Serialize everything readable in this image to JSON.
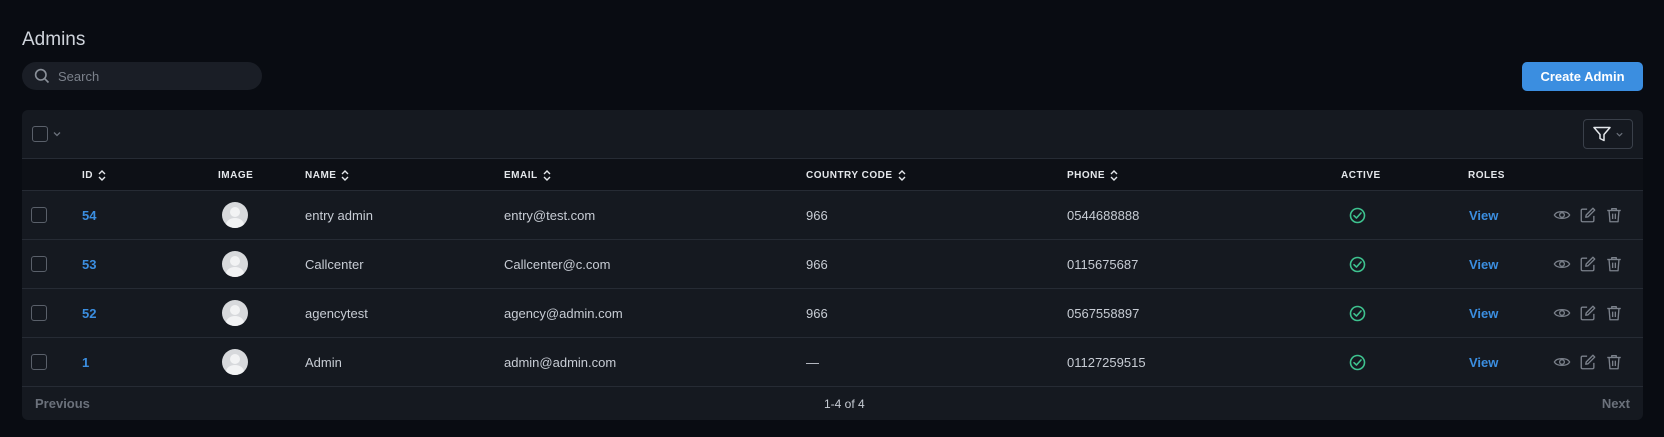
{
  "page": {
    "title": "Admins",
    "search_placeholder": "Search",
    "create_label": "Create Admin"
  },
  "table": {
    "columns": {
      "id": "ID",
      "image": "IMAGE",
      "name": "NAME",
      "email": "EMAIL",
      "country_code": "COUNTRY CODE",
      "phone": "PHONE",
      "active": "ACTIVE",
      "roles": "ROLES"
    },
    "rows": [
      {
        "id": "54",
        "name": "entry admin",
        "email": "entry@test.com",
        "country_code": "966",
        "phone": "0544688888",
        "active": true,
        "roles": "View"
      },
      {
        "id": "53",
        "name": "Callcenter",
        "email": "Callcenter@c.com",
        "country_code": "966",
        "phone": "0115675687",
        "active": true,
        "roles": "View"
      },
      {
        "id": "52",
        "name": "agencytest",
        "email": "agency@admin.com",
        "country_code": "966",
        "phone": "0567558897",
        "active": true,
        "roles": "View"
      },
      {
        "id": "1",
        "name": "Admin",
        "email": "admin@admin.com",
        "country_code": "—",
        "phone": "01127259515",
        "active": true,
        "roles": "View"
      }
    ]
  },
  "pagination": {
    "previous": "Previous",
    "range": "1-4 of 4",
    "next": "Next"
  },
  "colors": {
    "accent": "#3b8ee0",
    "active": "#3ec28f",
    "background": "#090c12",
    "panel": "#151920"
  }
}
